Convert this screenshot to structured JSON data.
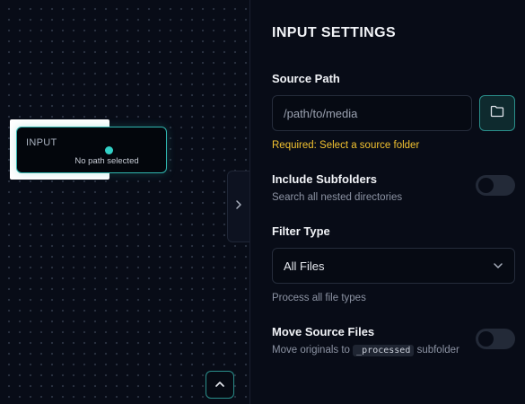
{
  "canvas": {
    "node": {
      "title": "INPUT",
      "subtitle": "No path selected",
      "port_color": "#32d0c6"
    }
  },
  "panel": {
    "title": "INPUT SETTINGS",
    "source_path": {
      "label": "Source Path",
      "value": "",
      "placeholder": "/path/to/media",
      "required_message": "Required: Select a source folder"
    },
    "include_subfolders": {
      "label": "Include Subfolders",
      "description": "Search all nested directories",
      "enabled": false
    },
    "filter_type": {
      "label": "Filter Type",
      "selected": "All Files",
      "description": "Process all file types"
    },
    "move_source_files": {
      "label": "Move Source Files",
      "description_prefix": "Move originals to",
      "description_code": "_processed",
      "description_suffix": "subfolder",
      "enabled": false
    }
  },
  "icons": {
    "collapse": "chevron-right-icon",
    "folder": "folder-icon",
    "dropdown": "chevron-down-icon",
    "up": "chevron-up-icon"
  },
  "colors": {
    "accent": "#2fb3ad",
    "warning": "#f2c230",
    "background": "#080c17"
  }
}
